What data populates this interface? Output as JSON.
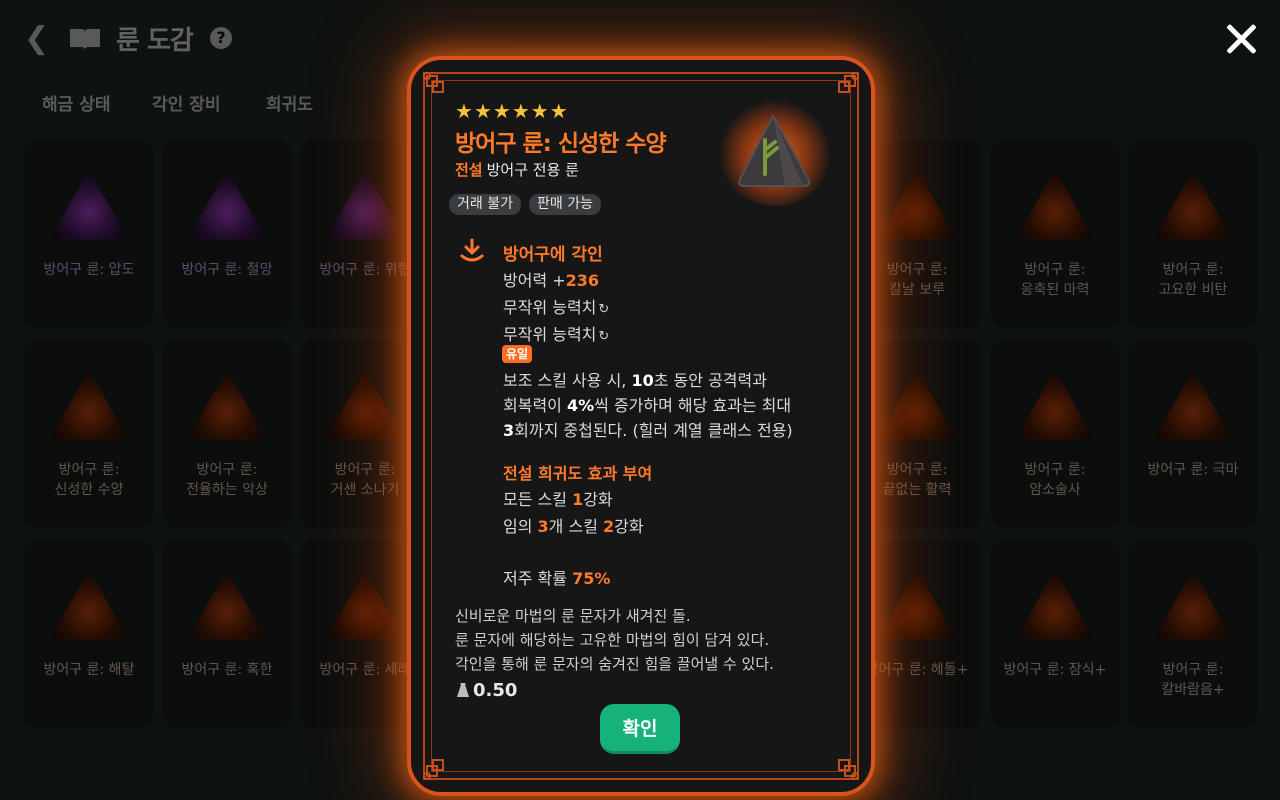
{
  "header": {
    "title": "룬 도감",
    "help": "?"
  },
  "filters": [
    "해금 상태",
    "각인 장비",
    "희귀도"
  ],
  "grid_cards": [
    [
      "방어구 룬: 압도",
      "방어구 룬: 절망",
      "방어구 룬: 위협"
    ],
    [
      "방어구 룬:",
      "신성한 수양"
    ],
    [
      "방어구 룬:",
      "전율하는 악상"
    ],
    [
      "방어구 룬:",
      "거센 소나기"
    ],
    [
      "방어구 룬: 해탈"
    ],
    [
      "방어구 룬: 혹한"
    ],
    [
      "방어구 룬: 세레"
    ],
    [
      "방어구 룬:",
      "칼날 보루"
    ],
    [
      "방어구 룬:",
      "응축된 마력"
    ],
    [
      "방어구 룬:",
      "고요한 비탄"
    ],
    [
      "방어구 룬:",
      "끝없는 활력"
    ],
    [
      "방어구 룬:",
      "암소술사"
    ],
    [
      "방어구 룬: 극마"
    ],
    [
      "방어구 룬: 헤돌+"
    ],
    [
      "방어구 룬: 잠식+"
    ],
    [
      "방어구 룬:",
      "칼바람음+"
    ]
  ],
  "modal": {
    "stars": [
      "★",
      "★",
      "★",
      "★",
      "★",
      "★"
    ],
    "title": "방어구 룬: 신성한 수양",
    "grade": "전설",
    "type": "방어구 전용 룬",
    "tags": [
      "거래 불가",
      "판매 가능"
    ],
    "engrave_title": "방어구에 각인",
    "defense_label": "방어력 +",
    "defense_value": "236",
    "random_stat_1": "무작위 능력치",
    "random_stat_2": "무작위 능력치",
    "refresh_symbol": "↻",
    "unique_badge": "유일",
    "unique_line1_a": "보조 스킬 사용 시, ",
    "unique_line1_b": "10",
    "unique_line1_c": "초 동안 공격력과",
    "unique_line2_a": "회복력이 ",
    "unique_line2_b": "4%",
    "unique_line2_c": "씩 증가하며 해당 효과는 최대",
    "unique_line3_a": "3",
    "unique_line3_b": "회까지 중첩된다. (힐러 계열 클래스 전용)",
    "bonus_title": "전설 희귀도 효과 부여",
    "bonus1_a": "모든 스킬 ",
    "bonus1_b": "1",
    "bonus1_c": "강화",
    "bonus2_a": "임의 ",
    "bonus2_b": "3",
    "bonus2_c": "개 스킬 ",
    "bonus2_d": "2",
    "bonus2_e": "강화",
    "curse_label": "저주 확률 ",
    "curse_value": "75%",
    "flavor": [
      "신비로운 마법의 룬 문자가 새겨진 돌.",
      "룬 문자에 해당하는 고유한 마법의 힘이 담겨 있다.",
      "각인을 통해 룬 문자의 숨겨진 힘을 끌어낼 수 있다."
    ],
    "weight": "0.50",
    "confirm": "확인"
  },
  "colors": {
    "accent": "#ff7a2b",
    "glow": "#e8611a",
    "confirm": "#17b27a",
    "star": "#f5c33b"
  }
}
